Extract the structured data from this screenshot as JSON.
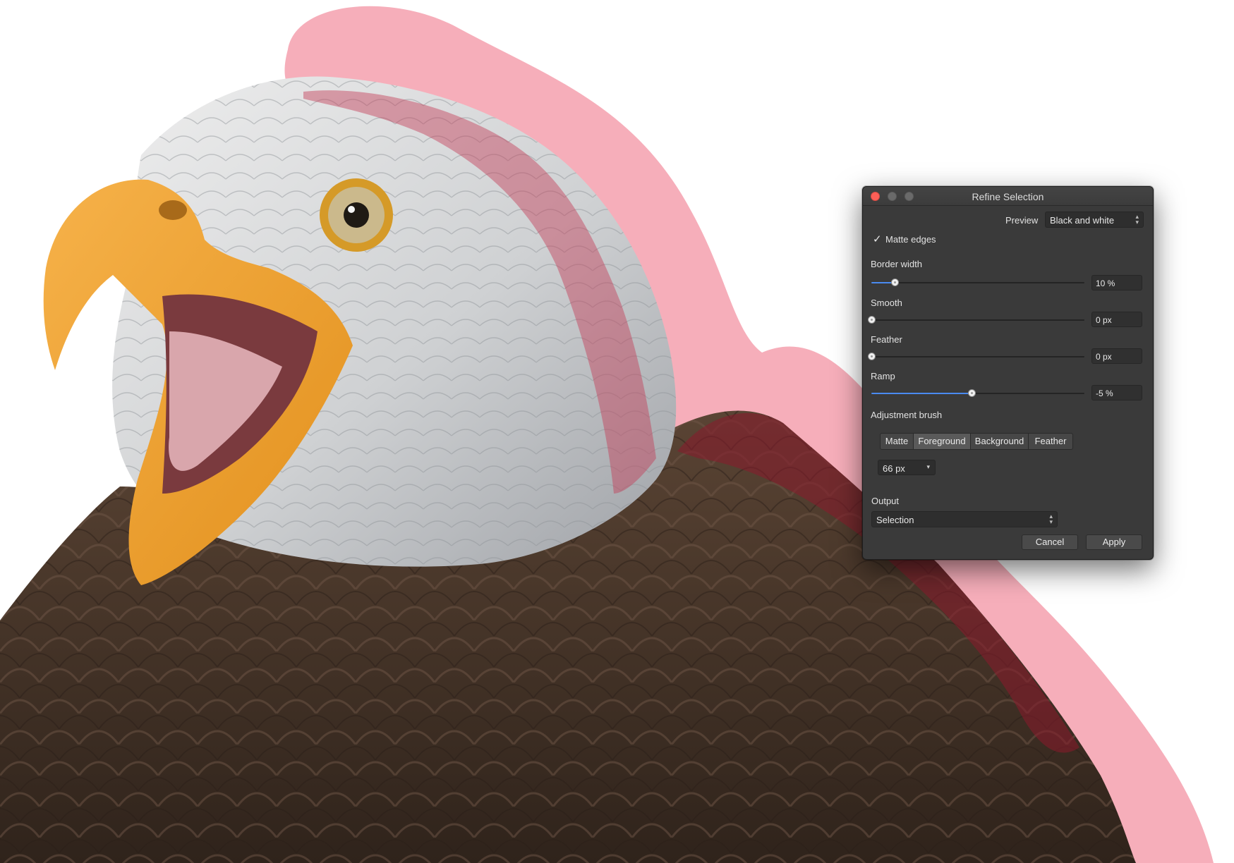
{
  "dialog": {
    "title": "Refine Selection",
    "preview": {
      "label": "Preview",
      "value": "Black and white"
    },
    "matte_edges": {
      "label": "Matte edges",
      "checked": true
    },
    "sliders": {
      "border_width": {
        "label": "Border width",
        "value_text": "10 %",
        "fraction": 0.11
      },
      "smooth": {
        "label": "Smooth",
        "value_text": "0 px",
        "fraction": 0.0
      },
      "feather": {
        "label": "Feather",
        "value_text": "0 px",
        "fraction": 0.0
      },
      "ramp": {
        "label": "Ramp",
        "value_text": "-5 %",
        "fraction": 0.47
      }
    },
    "adjustment_brush": {
      "label": "Adjustment brush",
      "modes": [
        "Matte",
        "Foreground",
        "Background",
        "Feather"
      ],
      "active_mode_index": 1,
      "size": "66 px"
    },
    "output": {
      "label": "Output",
      "value": "Selection"
    },
    "buttons": {
      "cancel": "Cancel",
      "apply": "Apply"
    }
  },
  "colors": {
    "overlay": "#f07c90",
    "dialog_bg": "#3a3a3a",
    "slider_fill": "#4a8af0",
    "close": "#fc5f57"
  }
}
